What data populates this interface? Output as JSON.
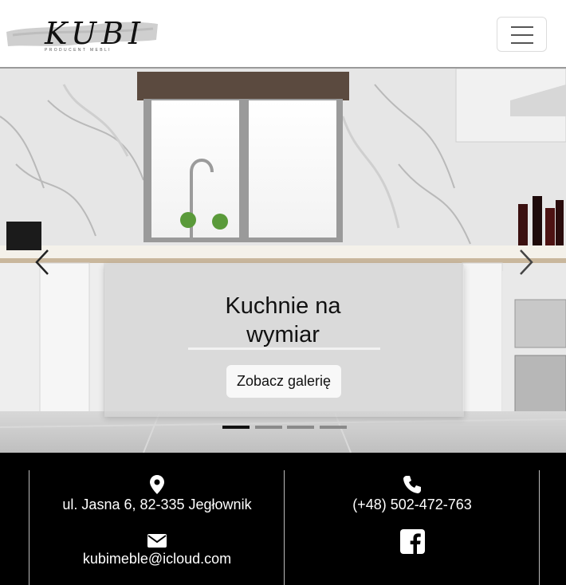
{
  "header": {
    "logo_text": "KUBI",
    "logo_subtitle": "PRODUCENT MEBLI",
    "menu_icon": "hamburger-menu-icon"
  },
  "hero": {
    "slide_title": "Kuchnie na wymiar",
    "slide_button": "Zobacz galerię",
    "indicator_count": 4,
    "active_indicator": 1,
    "prev_icon": "chevron-left-icon",
    "next_icon": "chevron-right-icon"
  },
  "footer": {
    "address": "ul. Jasna 6, 82-335 Jegłownik",
    "phone": "(+48) 502-472-763",
    "email": "kubimeble@icloud.com",
    "address_icon": "map-marker-icon",
    "phone_icon": "phone-icon",
    "email_icon": "envelope-icon",
    "social_icon": "facebook-icon"
  }
}
